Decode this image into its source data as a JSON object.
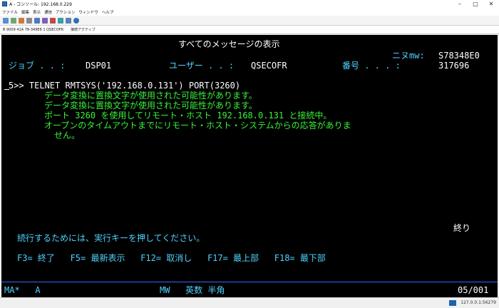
{
  "window": {
    "title": "A - コンソール: 192.168.0.229"
  },
  "menu": [
    "ファイル",
    "編集",
    "表示",
    "通信",
    "アクション",
    "ウィンドウ",
    "ヘルプ"
  ],
  "status_bar": {
    "items": [
      "B 9009 41A 78-349E6 1 QSECOFR",
      "接続アクティブ"
    ]
  },
  "terminal": {
    "title": "すべてのメッセージの表示",
    "id_label": "ニヌmw:",
    "id_value": "S78348E0",
    "job_label": "ジョブ . . :",
    "job_value": "DSP01",
    "user_label": "ユーザー . . :",
    "user_value": "QSECOFR",
    "number_label": "番号 . . . :",
    "number_value": "317696",
    "command": "5>> TELNET RMTSYS('192.168.0.131') PORT(3260)",
    "messages": [
      "データ変換に置換文字が使用された可能性があります。",
      "データ変換に置換文字が使用された可能性があります。",
      "ポート 3260 を使用してリモート・ホスト 192.168.0.131 と接続中。",
      "オープンのタイムアウトまでにリモート・ホスト・システムからの応答がありま",
      "せん。"
    ],
    "end_label": "終り",
    "continue_msg": "続行するためには、実行キーを押してください。",
    "fkeys": "F3= 終了   F5= 最新表示   F12= 取消し   F17= 最上部   F18= 最下部",
    "status_left": "MA*   A",
    "status_mid": "MW   英数 半角",
    "status_right": "05/001"
  },
  "taskbar": {
    "text": "127.0.0.1:56279"
  }
}
